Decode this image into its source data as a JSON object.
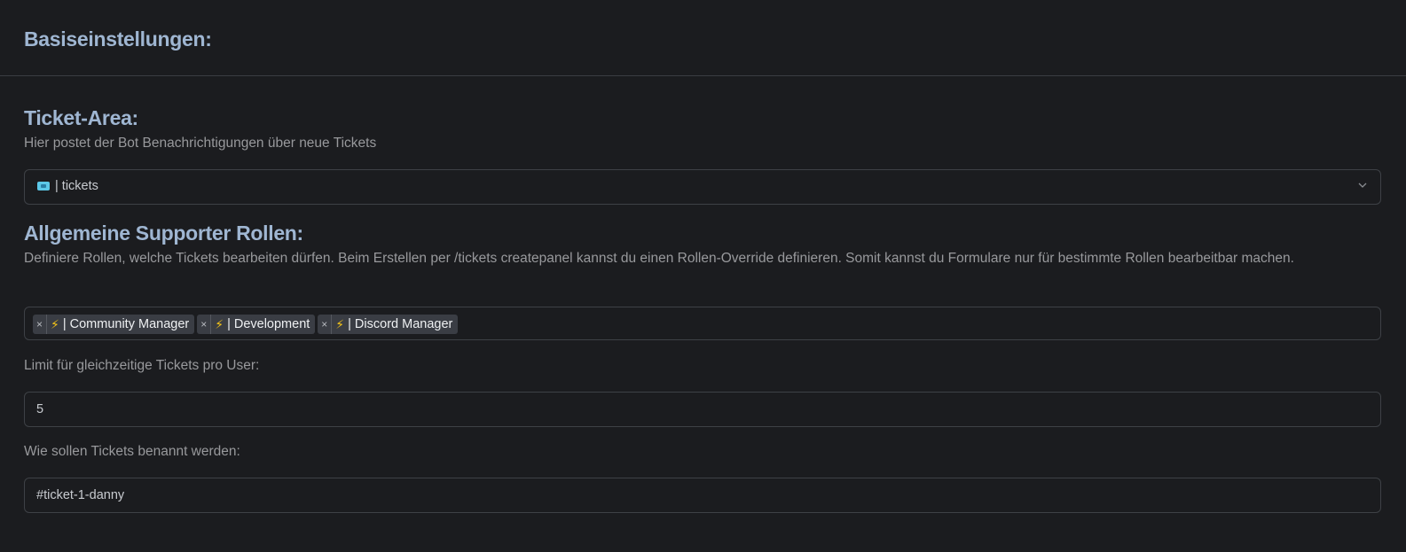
{
  "header": {
    "title": "Basiseinstellungen:"
  },
  "ticket_area": {
    "title": "Ticket-Area:",
    "description": "Hier postet der Bot Benachrichtigungen über neue Tickets",
    "selected_value": "| tickets",
    "icon": "ticket-emoji"
  },
  "supporter_roles": {
    "title": "Allgemeine Supporter Rollen:",
    "description": "Definiere Rollen, welche Tickets bearbeiten dürfen. Beim Erstellen per /tickets createpanel kannst du einen Rollen-Override definieren. Somit kannst du Formulare nur für bestimmte Rollen bearbeitbar machen.",
    "remove_symbol": "×",
    "tags": [
      {
        "icon": "⚡",
        "label": "| Community Manager"
      },
      {
        "icon": "⚡",
        "label": "| Development"
      },
      {
        "icon": "⚡",
        "label": "| Discord Manager"
      }
    ]
  },
  "ticket_limit": {
    "label": "Limit für gleichzeitige Tickets pro User:",
    "value": "5"
  },
  "ticket_name": {
    "label": "Wie sollen Tickets benannt werden:",
    "value": "#ticket-1-danny"
  },
  "colors": {
    "heading": "#9fb6d2",
    "background": "#1b1c1f",
    "border": "#3e4146",
    "tag_bg": "#3a3d44",
    "bolt": "#f5c518"
  }
}
